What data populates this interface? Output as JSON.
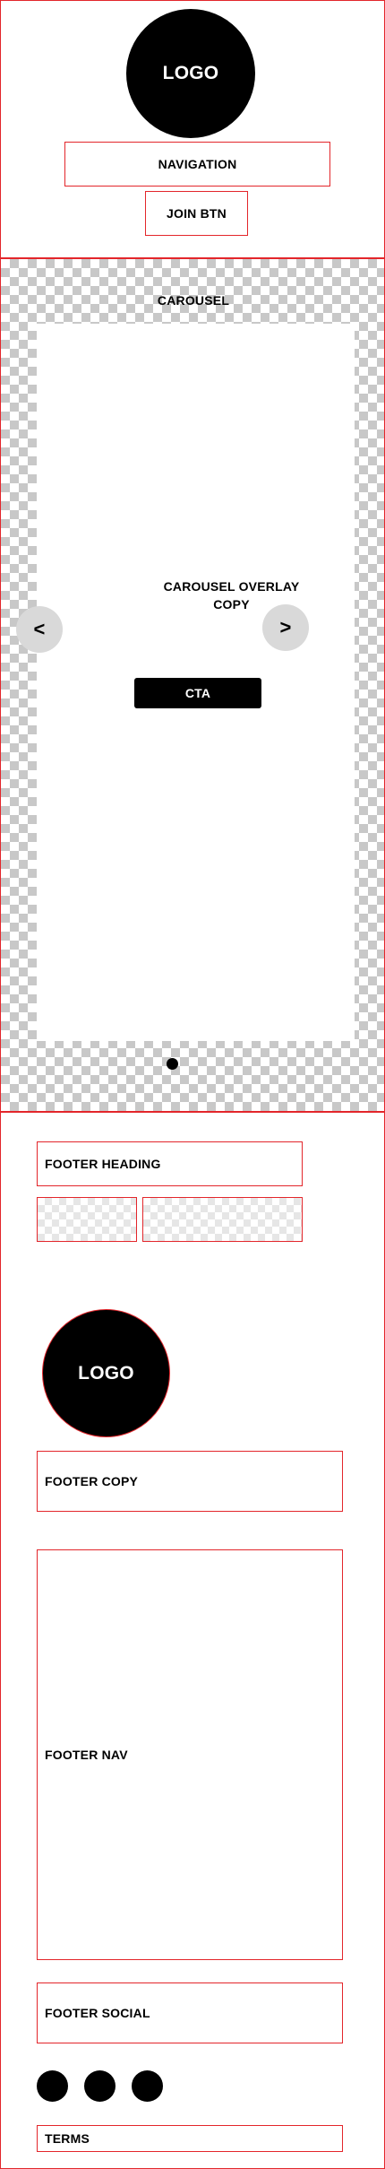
{
  "header": {
    "logo": "LOGO",
    "navigation": "NAVIGATION",
    "join_button": "JOIN BTN"
  },
  "carousel": {
    "title": "CAROUSEL",
    "overlay_copy": "CAROUSEL OVERLAY\nCOPY",
    "prev_label": "<",
    "next_label": ">",
    "cta_label": "CTA"
  },
  "footer": {
    "heading": "FOOTER HEADING",
    "logo": "LOGO",
    "copy": "FOOTER COPY",
    "nav": "FOOTER NAV",
    "social": "FOOTER SOCIAL",
    "terms": "TERMS"
  },
  "colors": {
    "outline": "#e3262b",
    "button_gray": "#d9d9d9",
    "black": "#000000"
  }
}
